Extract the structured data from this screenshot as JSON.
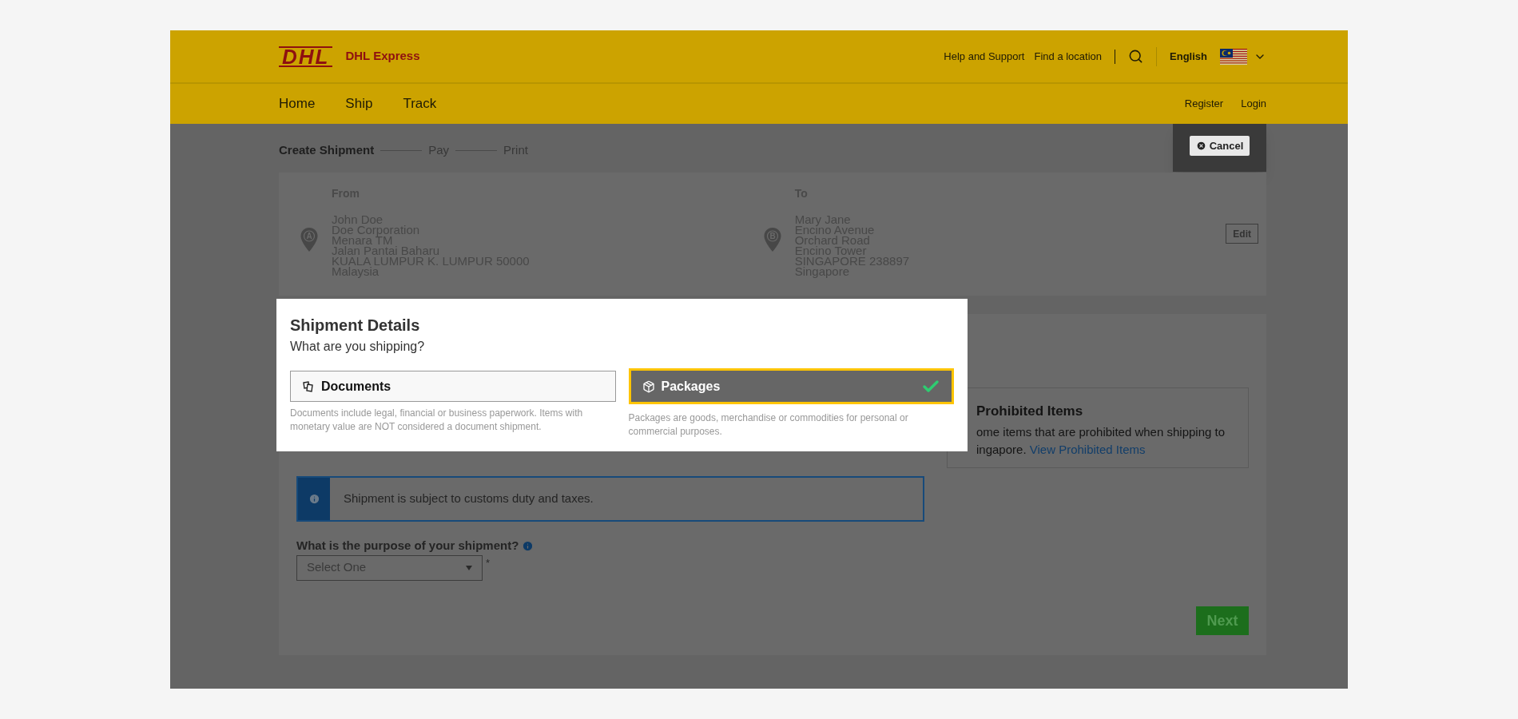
{
  "header": {
    "logo": "DHL",
    "brand": "DHL Express",
    "links": [
      "Help and Support",
      "Find a location"
    ],
    "language": "English"
  },
  "nav": {
    "items": [
      "Home",
      "Ship",
      "Track"
    ],
    "account_links": [
      "Register",
      "Login"
    ]
  },
  "steps": [
    {
      "label": "Create Shipment",
      "selected": true
    },
    {
      "label": "Pay",
      "selected": false
    },
    {
      "label": "Print",
      "selected": false
    }
  ],
  "cancel_button": "Cancel",
  "addresses": [
    {
      "heading": "From",
      "marker": "A",
      "lines": [
        "John Doe",
        "Doe Corporation",
        "Menara TM",
        "Jalan Pantai Baharu",
        "KUALA LUMPUR K. LUMPUR 50000",
        "Malaysia"
      ]
    },
    {
      "heading": "To",
      "marker": "B",
      "lines": [
        "Mary Jane",
        "Encino Avenue",
        "Orchard Road",
        "Encino Tower",
        "SINGAPORE 238897",
        "Singapore"
      ]
    }
  ],
  "edit_button": "Edit",
  "dialog": {
    "title": "Shipment Details",
    "subtitle": "What are you shipping?",
    "options": [
      {
        "kind": "documents",
        "label": "Documents",
        "description": "Documents include legal, financial or business paperwork. Items with monetary value are NOT considered a document shipment.",
        "selected": false
      },
      {
        "kind": "packages",
        "label": "Packages",
        "description": "Packages are goods, merchandise or commodities for personal or commercial purposes.",
        "selected": true
      }
    ]
  },
  "prohibited": {
    "title": "Prohibited Items",
    "lines": [
      "ome items that are prohibited when shipping to",
      "ingapore."
    ],
    "link": "View Prohibited Items"
  },
  "notice": "Shipment is subject to customs duty and taxes.",
  "purpose": {
    "label": "What is the purpose of your shipment?",
    "placeholder": "Select One",
    "required_mark": "*"
  },
  "next_button": "Next"
}
